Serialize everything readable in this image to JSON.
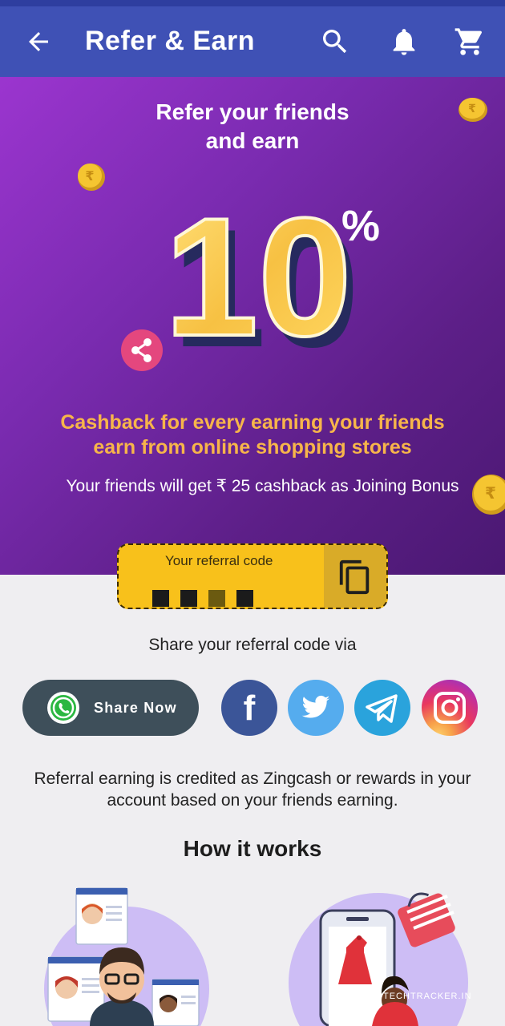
{
  "appbar": {
    "title": "Refer & Earn",
    "icons": [
      "back-arrow-icon",
      "search-icon",
      "bell-icon",
      "cart-icon"
    ]
  },
  "hero": {
    "headline_line1": "Refer your friends",
    "headline_line2": "and earn",
    "percent_value": "10",
    "percent_sign": "%",
    "cashback_line1": "Cashback for every earning your friends",
    "cashback_line2": "earn from online shopping stores",
    "bonus_text": "Your friends will get ₹ 25 cashback as Joining Bonus"
  },
  "referral": {
    "label": "Your referral code",
    "code": "■ ■ ■ ■"
  },
  "share": {
    "via_text": "Share your referral code via",
    "share_now_label": "Share Now",
    "channels": [
      "facebook",
      "twitter",
      "telegram",
      "instagram"
    ]
  },
  "info_text": "Referral earning is credited as Zingcash or rewards in your account based on your friends earning.",
  "how_it_works": {
    "title": "How it works"
  },
  "watermark": "TECHTRACKER.IN",
  "colors": {
    "appbar": "#3f51b5",
    "hero_start": "#9b35cf",
    "hero_end": "#4a1872",
    "accent_orange": "#f7b54a",
    "referral_yellow": "#f8c11b",
    "share_now_bg": "#3e4f5a"
  }
}
